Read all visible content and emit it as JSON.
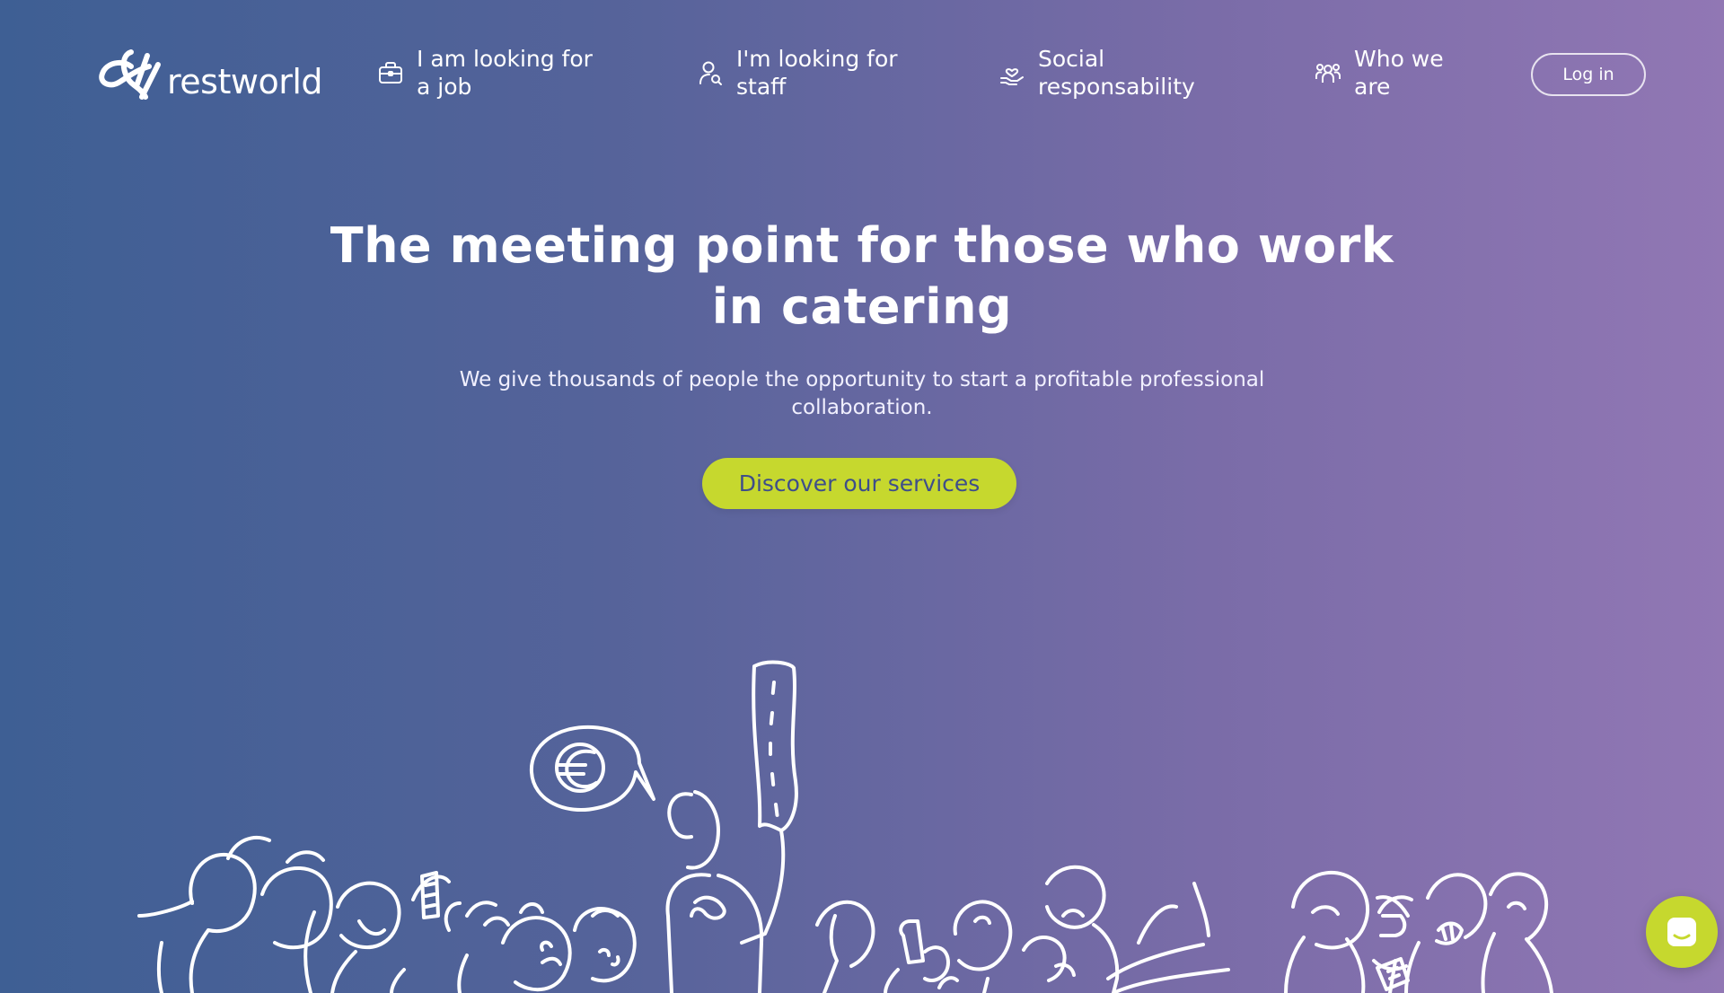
{
  "brand": {
    "name": "restworld"
  },
  "nav": {
    "items": [
      {
        "label": "I am looking for a job",
        "icon": "briefcase-icon"
      },
      {
        "label": "I'm looking for staff",
        "icon": "user-search-icon"
      },
      {
        "label": "Social responsability",
        "icon": "hand-heart-icon"
      },
      {
        "label": "Who we are",
        "icon": "group-icon"
      }
    ],
    "login_label": "Log in"
  },
  "hero": {
    "title": "The meeting point for those who work in catering",
    "subtitle": "We give thousands of people the opportunity to start a profitable professional collaboration.",
    "cta_label": "Discover our services"
  },
  "chat": {
    "icon": "chat-bubble-icon"
  },
  "colors": {
    "gradient_start": "#3e5f94",
    "gradient_end": "#9177b4",
    "accent": "#c6d82e",
    "cta_text": "#3e4e8a"
  }
}
